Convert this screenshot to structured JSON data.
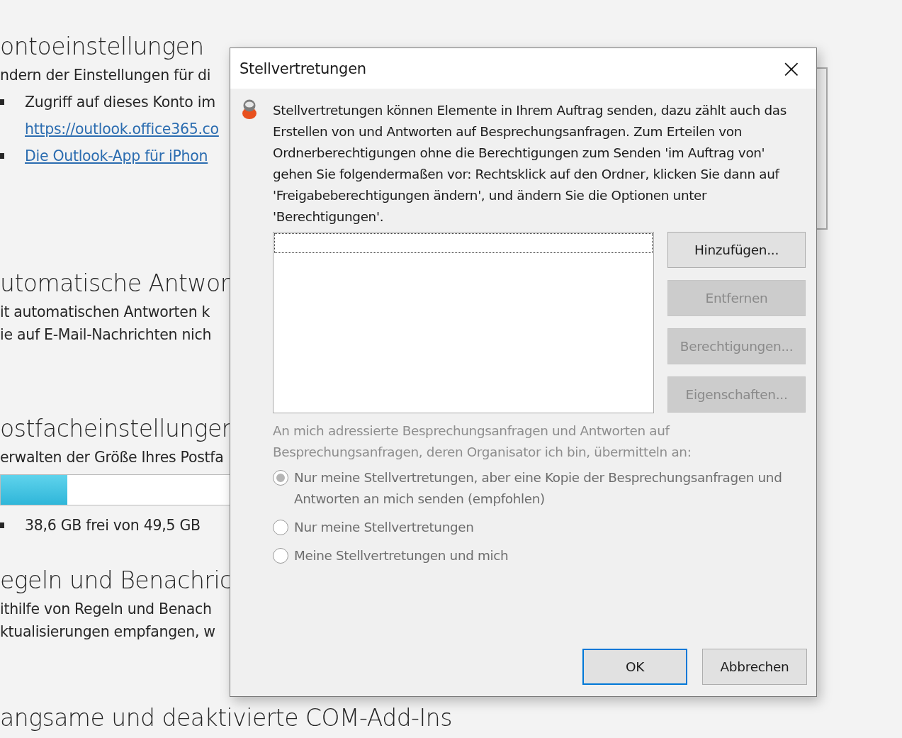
{
  "background": {
    "sections": [
      {
        "heading": "ontoeinstellungen",
        "items": [
          {
            "kind": "text",
            "text": "ndern der Einstellungen für di"
          },
          {
            "kind": "bullet",
            "text": "Zugriff auf dieses Konto im"
          },
          {
            "kind": "link",
            "text": "https://outlook.office365.co"
          },
          {
            "kind": "bullet-link",
            "text": "Die Outlook-App für iPhon"
          }
        ]
      },
      {
        "heading": "utomatische Antwor",
        "items": [
          {
            "kind": "text",
            "text": "it automatischen Antworten k"
          },
          {
            "kind": "text",
            "text": "ie auf E-Mail-Nachrichten nich"
          }
        ]
      },
      {
        "heading": "ostfacheinstellungen",
        "items": [
          {
            "kind": "text",
            "text": "erwalten der Größe Ihres Postfa"
          },
          {
            "kind": "meter",
            "level": 0.22
          },
          {
            "kind": "bullet",
            "text": "38,6 GB frei von 49,5 GB"
          }
        ]
      },
      {
        "heading": "egeln und Benachric",
        "items": [
          {
            "kind": "text",
            "text": "ithilfe von Regeln und Benach"
          },
          {
            "kind": "text",
            "text": "ktualisierungen empfangen, w"
          }
        ]
      },
      {
        "heading": "angsame und deaktivierte COM-Add-Ins"
      }
    ]
  },
  "dialog": {
    "title": "Stellvertretungen",
    "close": "×",
    "description": "Stellvertretungen können Elemente in Ihrem Auftrag senden, dazu zählt auch das Erstellen von und Antworten auf Besprechungsanfragen. Zum Erteilen von Ordnerberechtigungen ohne die Berechtigungen zum Senden 'im Auftrag von' gehen Sie folgendermaßen vor: Rechtsklick auf den Ordner, klicken Sie dann auf 'Freigabeberechtigungen ändern', und ändern Sie die Optionen unter 'Berechtigungen'.",
    "side_buttons": [
      {
        "label": "Hinzufügen...",
        "disabled": false
      },
      {
        "label": "Entfernen",
        "disabled": true
      },
      {
        "label": "Berechtigungen...",
        "disabled": true
      },
      {
        "label": "Eigenschaften...",
        "disabled": true
      }
    ],
    "delivery": {
      "caption": "An mich adressierte Besprechungsanfragen und Antworten auf Besprechungsanfragen, deren Organisator ich bin, übermitteln an:",
      "disabled": true,
      "options": [
        {
          "label": "Nur meine Stellvertretungen, aber eine Kopie der Besprechungsanfragen und Antworten an mich senden (empfohlen)",
          "selected": true
        },
        {
          "label": "Nur meine Stellvertretungen",
          "selected": false
        },
        {
          "label": "Meine Stellvertretungen und mich",
          "selected": false
        }
      ]
    },
    "buttons": [
      {
        "label": "OK",
        "default": true
      },
      {
        "label": "Abbrechen",
        "default": false
      }
    ]
  }
}
